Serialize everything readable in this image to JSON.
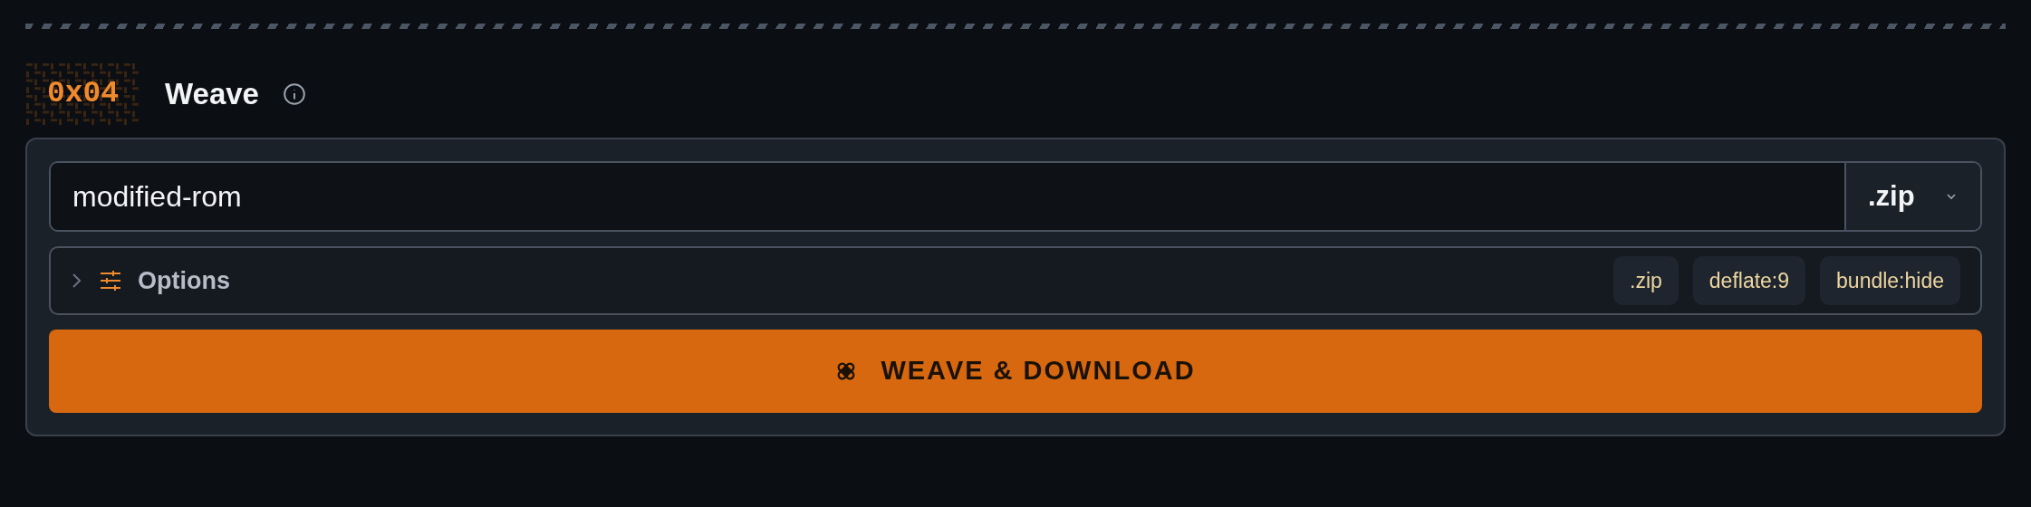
{
  "section": {
    "badge": "0x04",
    "title": "Weave"
  },
  "filename": {
    "value": "modified-rom"
  },
  "format_select": {
    "value": ".zip"
  },
  "options": {
    "label": "Options",
    "expanded": false,
    "tags": [
      ".zip",
      "deflate:9",
      "bundle:hide"
    ]
  },
  "action_button": {
    "label": "WEAVE & DOWNLOAD"
  }
}
